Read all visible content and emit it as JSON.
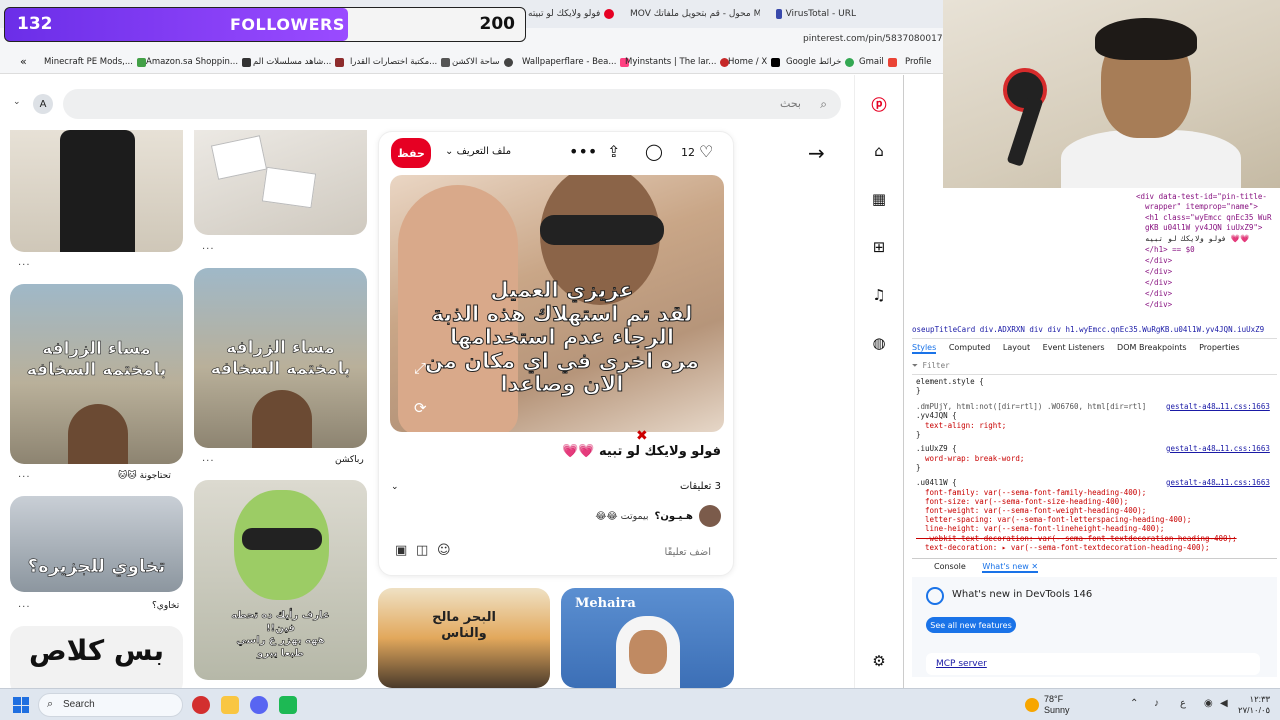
{
  "browser": {
    "tabs": [
      {
        "label": "فولو ولايكك لو تبيته",
        "color": "#e60023"
      },
      {
        "label": "MOV محول - قم بتحويل ملفاتك MOV",
        "color": "#e74c3c"
      },
      {
        "label": "VirusTotal - URL",
        "color": "#3949ab"
      }
    ],
    "url": "pinterest.com/pin/5837080017263",
    "bookmarks": [
      "Minecraft PE Mods,...",
      "Amazon.sa Shoppin...",
      "شاهد مسلسلات الم...",
      "مكتبة اختصارات القدرا...",
      "ساحة الاكشن",
      "Wallpaperflare - Bea...",
      "Myinstants | The lar...",
      "Home / X",
      "Google خرائط",
      "Gmail",
      "Profile"
    ]
  },
  "overlay": {
    "current": "132",
    "label": "FOLLOWERS",
    "goal": "200",
    "progress": 0.66
  },
  "pinterest": {
    "search_placeholder": "بحث",
    "avatar_letter": "A",
    "grid": {
      "col1_labels": [
        "...",
        "تحتاجونة 🐱🐱",
        "تخاوي؟"
      ],
      "col2_labels": [
        "...",
        "رباكشن"
      ],
      "texts": {
        "pin_zarafa": "مساء الزرافه\nبامختمه السخافه",
        "pin_tkhawi": "تخاوي للجزيره؟",
        "pin_bas": "بس كلاص",
        "pin_green": "عارف رأيك ده تحطه\nفين!!\nههه بهزر ع راسي\nطبعا يبرو"
      }
    },
    "closeup": {
      "save_label": "حفظ",
      "profile_label": "ملف التعريف",
      "likes": "12",
      "image_text": "عزيزي العميل\nلقد تم استهلاك هذه الذبة\nالرجاء عدم استخدامها\nمره اخرى في اي مكان من\nالان وصاعدا",
      "title": "فولو ولايكك لو تبيه 💗💗",
      "comments_header": "3 تعليقات",
      "comment_user": "هـيـون؟",
      "comment_text": "بيموتت 😂😂",
      "add_comment_placeholder": "أضف تعليقًا"
    },
    "bottom_pins": {
      "sea": "البحر مالح\nوالناس",
      "mehaira": "Mehaira"
    }
  },
  "devtools": {
    "html_lines": [
      "<div data-test-id=\"pin-title-",
      "  wrapper\" itemprop=\"name\">",
      "  <h1 class=\"wyEmcc qnEc35 WuR",
      "  gKB u04l1W yv4JQN iuUxZ9\">",
      "  فولو ولايكك لو تبيه 💗💗",
      "  </h1> == $0",
      "  </div>",
      "  </div>",
      "  </div>",
      "  </div>",
      "  </div>"
    ],
    "breadcrumbs": "oseupTitleCard  div.ADXRXN  div  div  h1.wyEmcc.qnEc35.WuRgKB.u04l1W.yv4JQN.iuUxZ9",
    "tabs": [
      "Styles",
      "Computed",
      "Layout",
      "Event Listeners",
      "DOM Breakpoints",
      "Properties"
    ],
    "filter": "Filter",
    "rules": [
      {
        "sel": "element.style {",
        "src": ""
      },
      {
        "sel": "}",
        "src": ""
      },
      {
        "sel": ".dmPUjY, html:not([dir=rtl]) .WO6760, html[dir=rtl]",
        "src": "gestalt-a48…11.css:1663"
      },
      {
        "sel": ".yv4JQN {",
        "src": ""
      },
      {
        "sel": "  text-align: right;",
        "src": ""
      },
      {
        "sel": "}",
        "src": ""
      },
      {
        "sel": ".iuUxZ9 {",
        "src": "gestalt-a48…11.css:1663"
      },
      {
        "sel": "  word-wrap: break-word;",
        "src": ""
      },
      {
        "sel": "}",
        "src": ""
      },
      {
        "sel": ".u04l1W {",
        "src": "gestalt-a48…11.css:1663"
      },
      {
        "sel": "  font-family: var(--sema-font-family-heading-400);",
        "src": ""
      },
      {
        "sel": "  font-size: var(--sema-font-size-heading-400);",
        "src": ""
      },
      {
        "sel": "  font-weight: var(--sema-font-weight-heading-400);",
        "src": ""
      },
      {
        "sel": "  letter-spacing: var(--sema-font-letterspacing-heading-400);",
        "src": ""
      },
      {
        "sel": "  line-height: var(--sema-font-lineheight-heading-400);",
        "src": ""
      },
      {
        "sel": "  -webkit-text-decoration: var(--sema-font-textdecoration-heading-400);",
        "src": ""
      },
      {
        "sel": "  text-decoration: ▸ var(--sema-font-textdecoration-heading-400);",
        "src": ""
      }
    ],
    "console_tabs": [
      "Console",
      "What's new ✕"
    ],
    "whatsnew_title": "What's new in DevTools 146",
    "whatsnew_button": "See all new features",
    "mcp": "MCP server"
  },
  "taskbar": {
    "search": "Search",
    "temp": "78°F",
    "weather": "Sunny",
    "time": "١٢:٣٣",
    "date": "٢٧/١٠/٠٥",
    "lang": "ع"
  }
}
